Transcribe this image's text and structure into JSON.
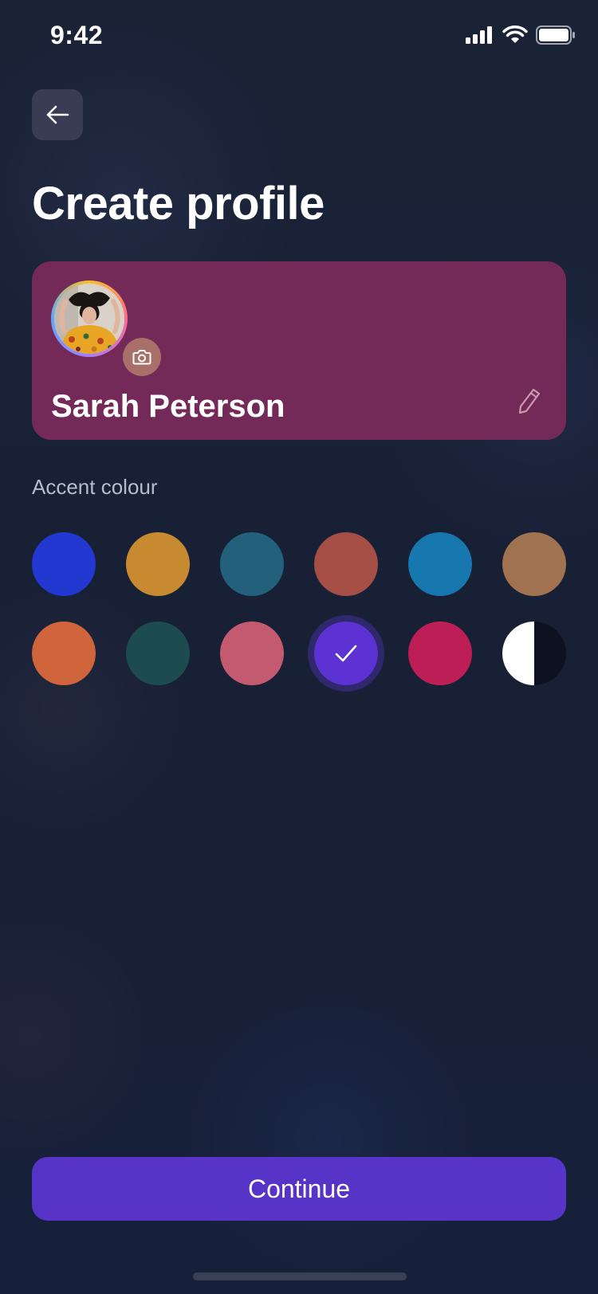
{
  "status_bar": {
    "time": "9:42"
  },
  "header": {
    "back_icon": "arrow-left-icon",
    "title": "Create profile"
  },
  "profile_card": {
    "name": "Sarah Peterson",
    "card_color": "#742a58",
    "camera_icon": "camera-icon",
    "edit_icon": "pencil-icon"
  },
  "accent": {
    "label": "Accent colour",
    "colors": [
      {
        "hex": "#2338d0",
        "selected": false
      },
      {
        "hex": "#c88a30",
        "selected": false
      },
      {
        "hex": "#23607c",
        "selected": false
      },
      {
        "hex": "#a44e46",
        "selected": false
      },
      {
        "hex": "#1778b0",
        "selected": false
      },
      {
        "hex": "#a07250",
        "selected": false
      },
      {
        "hex": "#d0643a",
        "selected": false
      },
      {
        "hex": "#1c4c4f",
        "selected": false
      },
      {
        "hex": "#c45a70",
        "selected": false
      },
      {
        "hex": "#5c32d2",
        "selected": true
      },
      {
        "hex": "#be1e56",
        "selected": false
      },
      {
        "hex": "#ffffff/#0c1220",
        "selected": false
      }
    ]
  },
  "footer": {
    "continue_label": "Continue",
    "button_color": "#5734c7"
  }
}
